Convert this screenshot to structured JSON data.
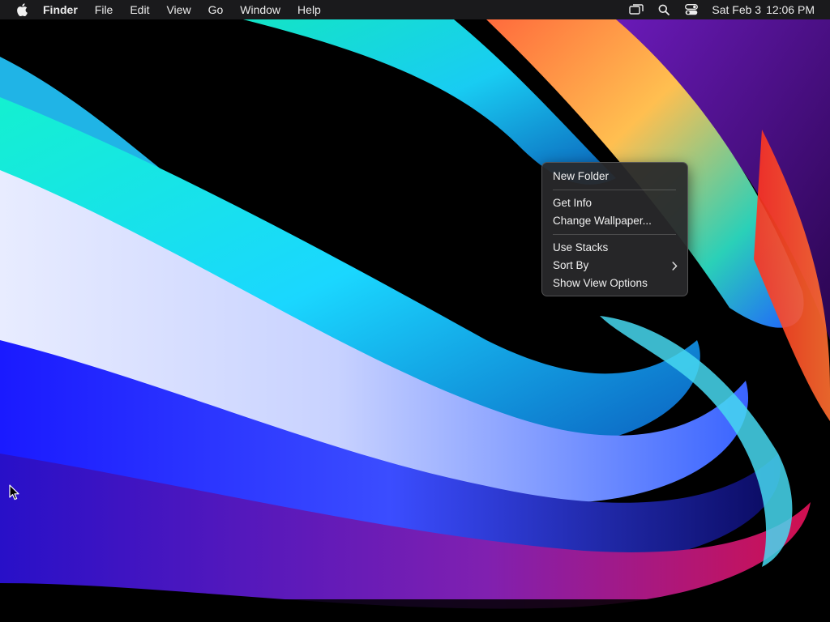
{
  "menubar": {
    "apple_icon": "apple-logo-icon",
    "app_name": "Finder",
    "menus": [
      "File",
      "Edit",
      "View",
      "Go",
      "Window",
      "Help"
    ],
    "status_icons": [
      "screen-mirroring-icon",
      "search-icon",
      "control-center-icon"
    ],
    "date": "Sat Feb 3",
    "time": "12:06 PM"
  },
  "context_menu": {
    "groups": [
      [
        {
          "label": "New Folder"
        }
      ],
      [
        {
          "label": "Get Info"
        },
        {
          "label": "Change Wallpaper..."
        }
      ],
      [
        {
          "label": "Use Stacks"
        },
        {
          "label": "Sort By",
          "submenu": true
        },
        {
          "label": "Show View Options"
        }
      ]
    ],
    "submenu_icon": "chevron-right-icon"
  },
  "colors": {
    "menubar_bg": "#1c1c1e",
    "menu_bg": "#28282a",
    "text": "#f0f0f0"
  }
}
